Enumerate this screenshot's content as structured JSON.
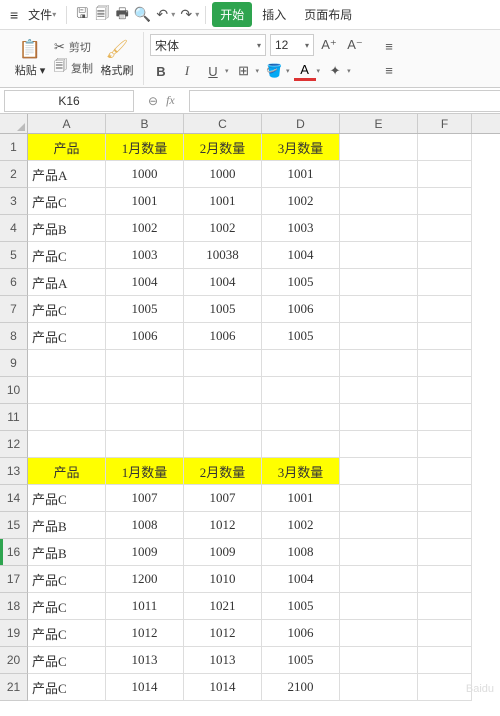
{
  "menubar": {
    "file": "文件",
    "start": "开始",
    "insert": "插入",
    "pageLayout": "页面布局"
  },
  "ribbon": {
    "paste": "粘贴",
    "cut": "剪切",
    "copy": "复制",
    "formatPainter": "格式刷",
    "fontName": "宋体",
    "fontSize": "12",
    "bold": "B",
    "italic": "I",
    "underline": "U"
  },
  "namebox": "K16",
  "fx": "fx",
  "columns": [
    "A",
    "B",
    "C",
    "D",
    "E",
    "F"
  ],
  "rows": [
    {
      "n": 1,
      "hdr": true,
      "cells": [
        "产品",
        "1月数量",
        "2月数量",
        "3月数量"
      ]
    },
    {
      "n": 2,
      "hdr": false,
      "cells": [
        "产品A",
        "1000",
        "1000",
        "1001"
      ]
    },
    {
      "n": 3,
      "hdr": false,
      "cells": [
        "产品C",
        "1001",
        "1001",
        "1002"
      ]
    },
    {
      "n": 4,
      "hdr": false,
      "cells": [
        "产品B",
        "1002",
        "1002",
        "1003"
      ]
    },
    {
      "n": 5,
      "hdr": false,
      "cells": [
        "产品C",
        "1003",
        "10038",
        "1004"
      ]
    },
    {
      "n": 6,
      "hdr": false,
      "cells": [
        "产品A",
        "1004",
        "1004",
        "1005"
      ]
    },
    {
      "n": 7,
      "hdr": false,
      "cells": [
        "产品C",
        "1005",
        "1005",
        "1006"
      ]
    },
    {
      "n": 8,
      "hdr": false,
      "cells": [
        "产品C",
        "1006",
        "1006",
        "1005"
      ]
    },
    {
      "n": 9,
      "hdr": false,
      "cells": [
        "",
        "",
        "",
        ""
      ]
    },
    {
      "n": 10,
      "hdr": false,
      "cells": [
        "",
        "",
        "",
        ""
      ]
    },
    {
      "n": 11,
      "hdr": false,
      "cells": [
        "",
        "",
        "",
        ""
      ]
    },
    {
      "n": 12,
      "hdr": false,
      "cells": [
        "",
        "",
        "",
        ""
      ]
    },
    {
      "n": 13,
      "hdr": true,
      "cells": [
        "产品",
        "1月数量",
        "2月数量",
        "3月数量"
      ]
    },
    {
      "n": 14,
      "hdr": false,
      "cells": [
        "产品C",
        "1007",
        "1007",
        "1001"
      ]
    },
    {
      "n": 15,
      "hdr": false,
      "cells": [
        "产品B",
        "1008",
        "1012",
        "1002"
      ]
    },
    {
      "n": 16,
      "hdr": false,
      "cells": [
        "产品B",
        "1009",
        "1009",
        "1008"
      ],
      "active": true
    },
    {
      "n": 17,
      "hdr": false,
      "cells": [
        "产品C",
        "1200",
        "1010",
        "1004"
      ]
    },
    {
      "n": 18,
      "hdr": false,
      "cells": [
        "产品C",
        "1011",
        "1021",
        "1005"
      ]
    },
    {
      "n": 19,
      "hdr": false,
      "cells": [
        "产品C",
        "1012",
        "1012",
        "1006"
      ]
    },
    {
      "n": 20,
      "hdr": false,
      "cells": [
        "产品C",
        "1013",
        "1013",
        "1005"
      ]
    },
    {
      "n": 21,
      "hdr": false,
      "cells": [
        "产品C",
        "1014",
        "1014",
        "2100"
      ]
    }
  ],
  "chart_data": [
    {
      "type": "table",
      "title": "",
      "columns": [
        "产品",
        "1月数量",
        "2月数量",
        "3月数量"
      ],
      "rows": [
        [
          "产品A",
          1000,
          1000,
          1001
        ],
        [
          "产品C",
          1001,
          1001,
          1002
        ],
        [
          "产品B",
          1002,
          1002,
          1003
        ],
        [
          "产品C",
          1003,
          10038,
          1004
        ],
        [
          "产品A",
          1004,
          1004,
          1005
        ],
        [
          "产品C",
          1005,
          1005,
          1006
        ],
        [
          "产品C",
          1006,
          1006,
          1005
        ]
      ]
    },
    {
      "type": "table",
      "title": "",
      "columns": [
        "产品",
        "1月数量",
        "2月数量",
        "3月数量"
      ],
      "rows": [
        [
          "产品C",
          1007,
          1007,
          1001
        ],
        [
          "产品B",
          1008,
          1012,
          1002
        ],
        [
          "产品B",
          1009,
          1009,
          1008
        ],
        [
          "产品C",
          1200,
          1010,
          1004
        ],
        [
          "产品C",
          1011,
          1021,
          1005
        ],
        [
          "产品C",
          1012,
          1012,
          1006
        ],
        [
          "产品C",
          1013,
          1013,
          1005
        ],
        [
          "产品C",
          1014,
          1014,
          2100
        ]
      ]
    }
  ],
  "watermark": "Baidu"
}
